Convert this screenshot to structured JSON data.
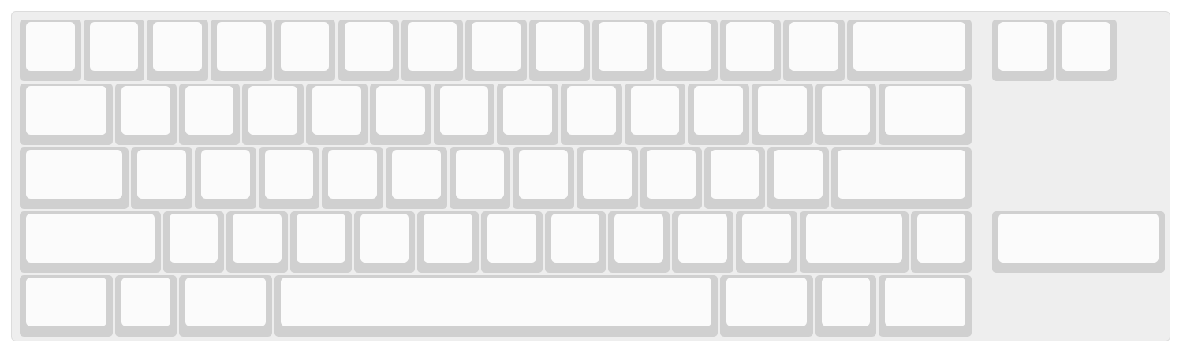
{
  "keyboard": {
    "colors": {
      "frame_background": "#eeeeee",
      "frame_border": "#dcdcdc",
      "key_base": "#d0d0d0",
      "key_cap": "#fbfbfb"
    },
    "blocks": {
      "main": {
        "rows": [
          {
            "keys": [
              {
                "units": 1
              },
              {
                "units": 1
              },
              {
                "units": 1
              },
              {
                "units": 1
              },
              {
                "units": 1
              },
              {
                "units": 1
              },
              {
                "units": 1
              },
              {
                "units": 1
              },
              {
                "units": 1
              },
              {
                "units": 1
              },
              {
                "units": 1
              },
              {
                "units": 1
              },
              {
                "units": 1
              },
              {
                "units": 2
              }
            ]
          },
          {
            "keys": [
              {
                "units": 1.5
              },
              {
                "units": 1
              },
              {
                "units": 1
              },
              {
                "units": 1
              },
              {
                "units": 1
              },
              {
                "units": 1
              },
              {
                "units": 1
              },
              {
                "units": 1
              },
              {
                "units": 1
              },
              {
                "units": 1
              },
              {
                "units": 1
              },
              {
                "units": 1
              },
              {
                "units": 1
              },
              {
                "units": 1.5
              }
            ]
          },
          {
            "keys": [
              {
                "units": 1.75
              },
              {
                "units": 1
              },
              {
                "units": 1
              },
              {
                "units": 1
              },
              {
                "units": 1
              },
              {
                "units": 1
              },
              {
                "units": 1
              },
              {
                "units": 1
              },
              {
                "units": 1
              },
              {
                "units": 1
              },
              {
                "units": 1
              },
              {
                "units": 1
              },
              {
                "units": 2.25
              }
            ]
          },
          {
            "keys": [
              {
                "units": 2.25
              },
              {
                "units": 1
              },
              {
                "units": 1
              },
              {
                "units": 1
              },
              {
                "units": 1
              },
              {
                "units": 1
              },
              {
                "units": 1
              },
              {
                "units": 1
              },
              {
                "units": 1
              },
              {
                "units": 1
              },
              {
                "units": 1
              },
              {
                "units": 1.75
              },
              {
                "units": 1
              }
            ]
          },
          {
            "keys": [
              {
                "units": 1.5
              },
              {
                "units": 1
              },
              {
                "units": 1.5
              },
              {
                "units": 7
              },
              {
                "units": 1.5
              },
              {
                "units": 1
              },
              {
                "units": 1.5
              }
            ]
          }
        ]
      },
      "side": {
        "rows": [
          {
            "keys": [
              {
                "units": 1
              },
              {
                "units": 1
              }
            ]
          },
          {
            "keys": []
          },
          {
            "keys": []
          },
          {
            "keys": [
              {
                "units": 2.75
              }
            ]
          },
          {
            "keys": []
          }
        ]
      }
    }
  }
}
